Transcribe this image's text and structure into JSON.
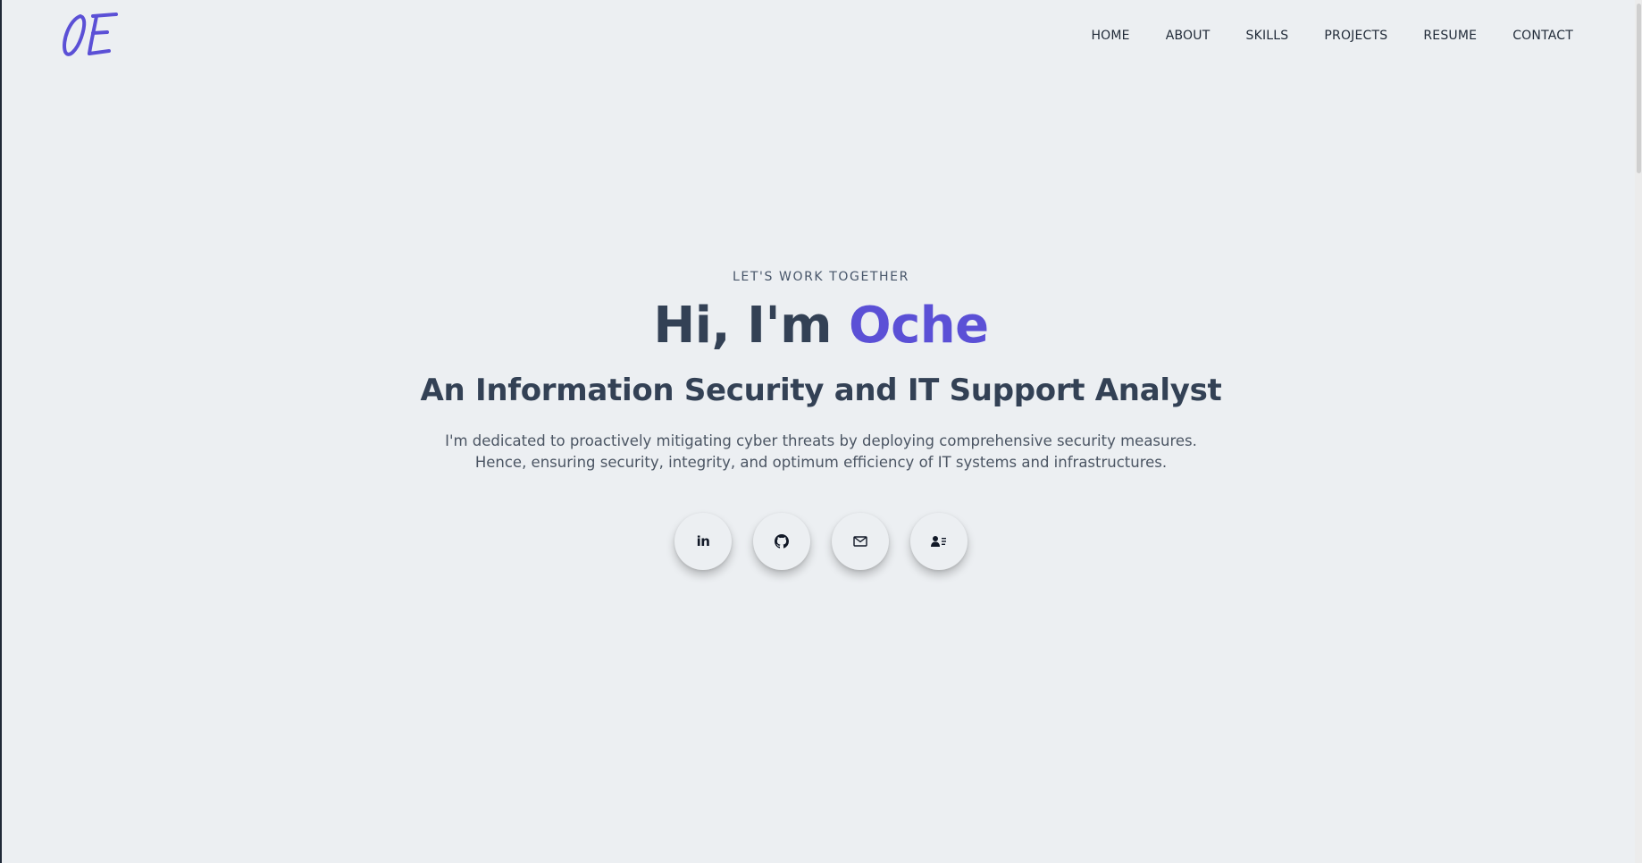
{
  "header": {
    "logo_text": "OE",
    "nav": [
      {
        "label": "HOME"
      },
      {
        "label": "ABOUT"
      },
      {
        "label": "SKILLS"
      },
      {
        "label": "PROJECTS"
      },
      {
        "label": "RESUME"
      },
      {
        "label": "CONTACT"
      }
    ]
  },
  "hero": {
    "eyebrow": "LET'S WORK TOGETHER",
    "greeting": "Hi, I'm ",
    "name": "Oche",
    "subtitle": "An Information Security and IT Support Analyst",
    "intro": "I'm dedicated to proactively mitigating cyber threats by deploying comprehensive security measures. Hence, ensuring security, integrity, and optimum efficiency of IT systems and infrastructures."
  },
  "socials": [
    {
      "icon": "linkedin-icon",
      "text": "in"
    },
    {
      "icon": "github-icon"
    },
    {
      "icon": "mail-icon"
    },
    {
      "icon": "contact-card-icon"
    }
  ],
  "colors": {
    "background": "#eceff2",
    "accent": "#5b50d6",
    "heading": "#334155",
    "body_text": "#4b5563"
  }
}
